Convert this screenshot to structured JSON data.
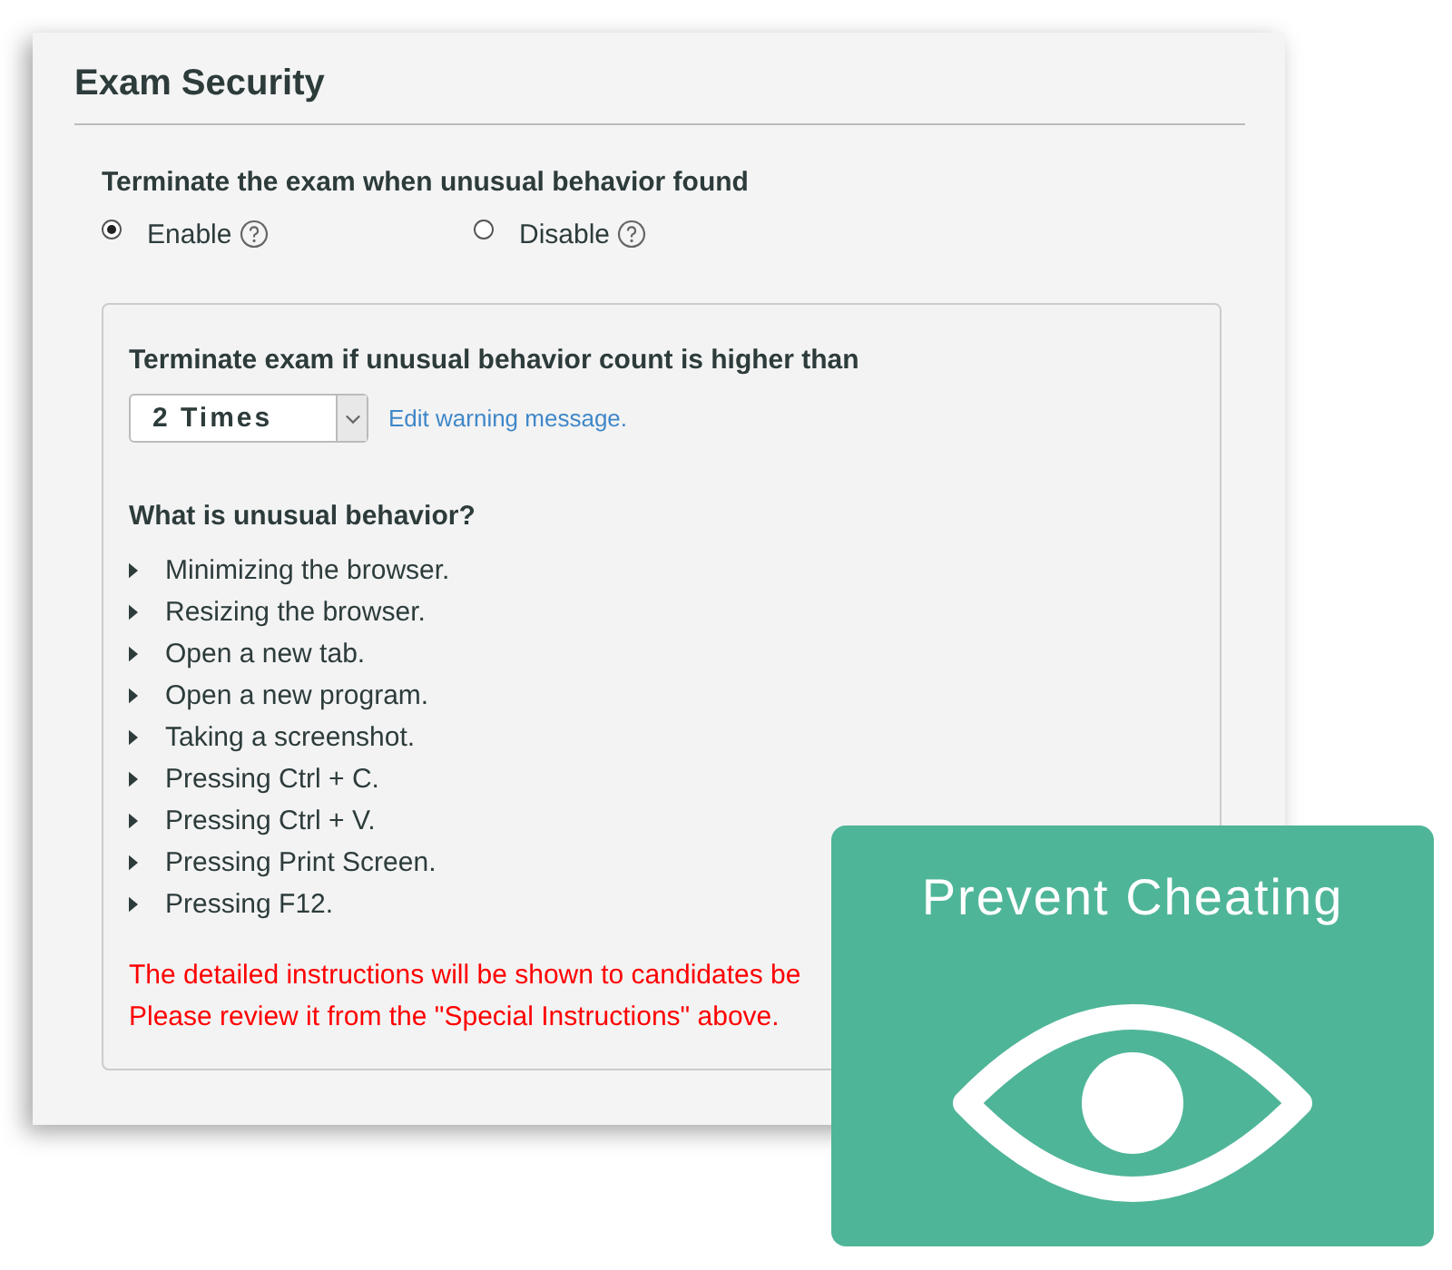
{
  "section": {
    "title": "Exam Security"
  },
  "terminate": {
    "label": "Terminate the exam when unusual behavior found",
    "options": [
      {
        "label": "Enable",
        "selected": true
      },
      {
        "label": "Disable",
        "selected": false
      }
    ]
  },
  "threshold": {
    "label": "Terminate exam if unusual behavior count is higher than",
    "value": "2 Times",
    "link": "Edit warning message."
  },
  "behaviors": {
    "title": "What is unusual behavior?",
    "items": [
      "Minimizing the browser.",
      "Resizing the browser.",
      "Open a new tab.",
      "Open a new program.",
      "Taking a screenshot.",
      "Pressing Ctrl + C.",
      "Pressing Ctrl + V.",
      "Pressing Print Screen.",
      "Pressing F12."
    ]
  },
  "notice": [
    "The detailed instructions will be shown to candidates be",
    "Please review it from the \"Special Instructions\" above."
  ],
  "promo": {
    "title": "Prevent Cheating"
  }
}
